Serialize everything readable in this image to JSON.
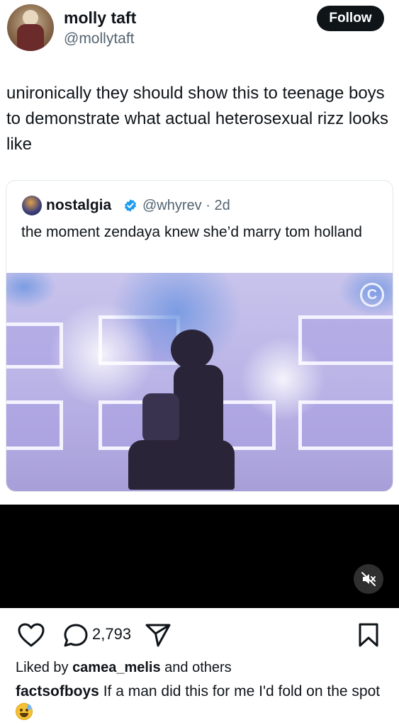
{
  "post": {
    "author_name": "molly taft",
    "author_handle": "@mollytaft",
    "follow_label": "Follow",
    "text": "unironically they should show this to teenage boys to demonstrate what actual heterosexual rizz looks like"
  },
  "quoted_post": {
    "author_name": "nostalgia",
    "author_handle": "@whyrev",
    "time_sep": "·",
    "time": "2d",
    "text": "the moment zendaya knew she’d marry tom holland",
    "watermark": "C"
  },
  "video": {
    "muted": true
  },
  "actions": {
    "comment_count": "2,793"
  },
  "likes": {
    "prefix": "Liked by",
    "user": "camea_melis",
    "suffix": "and others"
  },
  "caption": {
    "user": "factsofboys",
    "text": "If a man did this for me I'd fold on the spot"
  },
  "colors": {
    "text": "#0f1419",
    "muted": "#536471",
    "verified": "#1d9bf0",
    "follow_bg": "#0f1419"
  },
  "icons": [
    "heart-icon",
    "comment-icon",
    "share-icon",
    "bookmark-icon",
    "muted-speaker-icon",
    "verified-badge-icon"
  ]
}
